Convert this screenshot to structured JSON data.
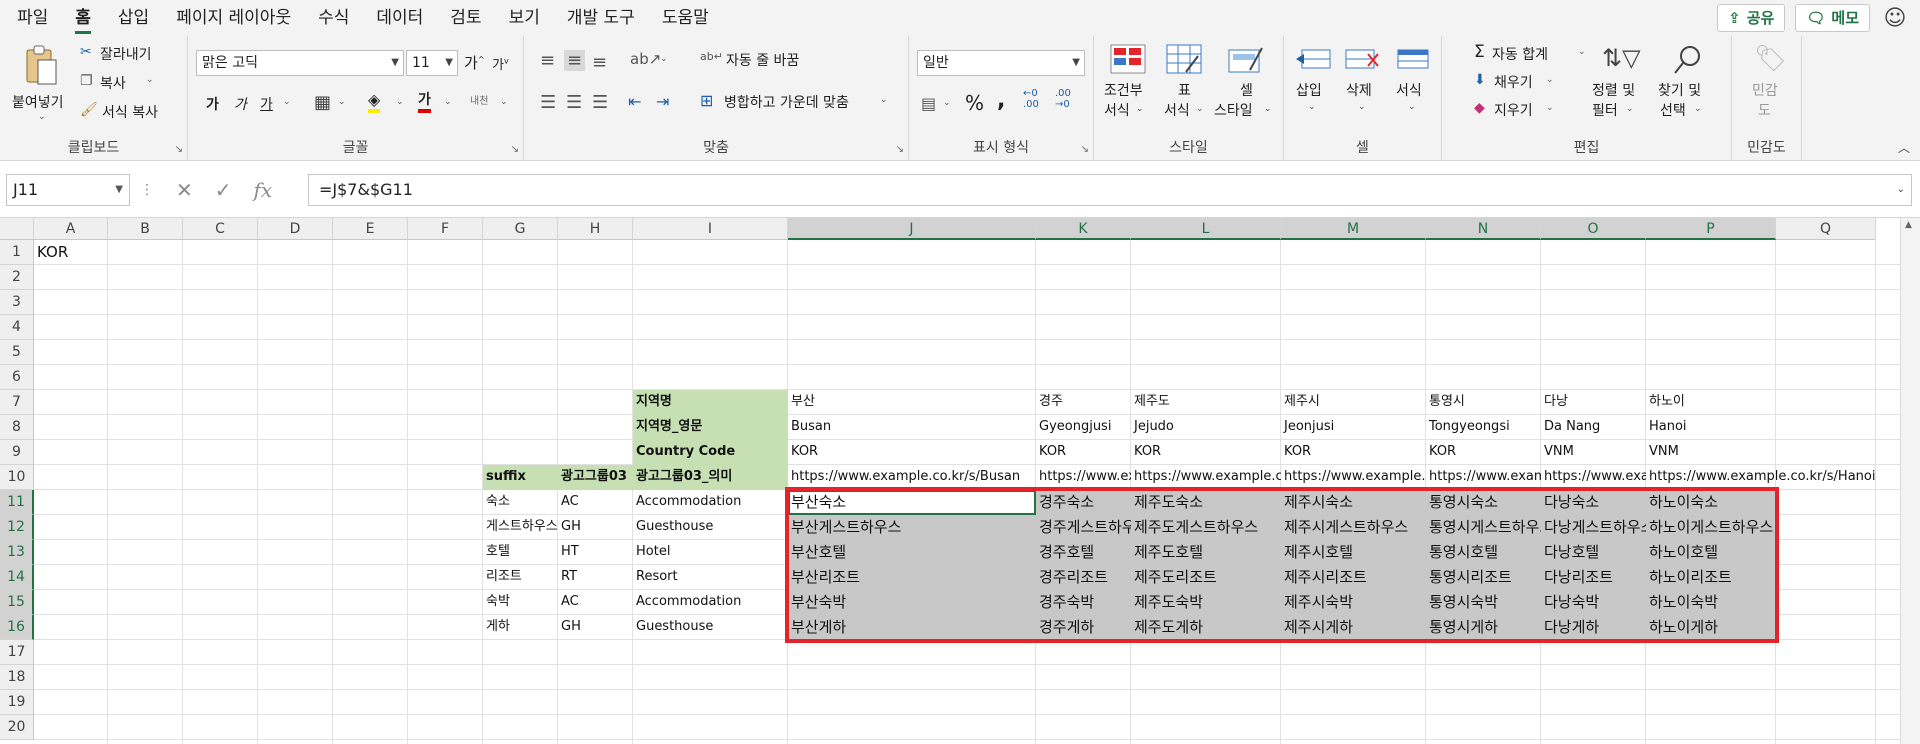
{
  "menu": {
    "tabs": [
      "파일",
      "홈",
      "삽입",
      "페이지 레이아웃",
      "수식",
      "데이터",
      "검토",
      "보기",
      "개발 도구",
      "도움말"
    ],
    "active_tab": "홈",
    "share_label": "공유",
    "comments_label": "메모"
  },
  "ribbon": {
    "clipboard": {
      "paste": "붙여넣기",
      "cut": "잘라내기",
      "copy": "복사",
      "format_painter": "서식 복사",
      "label": "클립보드"
    },
    "font": {
      "name": "맑은 고딕",
      "size": "11",
      "bold": "가",
      "italic": "가",
      "underline": "가",
      "font_color_glyph": "가",
      "phonetic": "내천",
      "label": "글꼴"
    },
    "alignment": {
      "wrap": "자동 줄 바꿈",
      "merge": "병합하고 가운데 맞춤",
      "label": "맞춤"
    },
    "number": {
      "format": "일반",
      "percent": "%",
      "comma": ",",
      "inc_decimal": ".00",
      "dec_decimal": ".00",
      "label": "표시 형식"
    },
    "styles": {
      "conditional": [
        "조건부",
        "서식"
      ],
      "table": [
        "표",
        "서식"
      ],
      "cell_styles": [
        "셀",
        "스타일"
      ],
      "label": "스타일"
    },
    "cells": {
      "insert": "삽입",
      "delete": "삭제",
      "format": "서식",
      "label": "셀"
    },
    "editing": {
      "autosum": "자동 합계",
      "fill": "채우기",
      "clear": "지우기",
      "sort": [
        "정렬 및",
        "필터"
      ],
      "find": [
        "찾기 및",
        "선택"
      ],
      "label": "편집"
    },
    "sensitivity": {
      "button": [
        "민감",
        "도"
      ],
      "label": "민감도"
    }
  },
  "formula_bar": {
    "name_box": "J11",
    "formula": "=J$7&$G11",
    "fx": "fx"
  },
  "sheet": {
    "columns": [
      "A",
      "B",
      "C",
      "D",
      "E",
      "F",
      "G",
      "H",
      "I",
      "J",
      "K",
      "L",
      "M",
      "N",
      "O",
      "P",
      "Q"
    ],
    "selected_columns": [
      "J",
      "K",
      "L",
      "M",
      "N",
      "O",
      "P"
    ],
    "rows": [
      "1",
      "2",
      "3",
      "4",
      "5",
      "6",
      "7",
      "8",
      "9",
      "10",
      "11",
      "12",
      "13",
      "14",
      "15",
      "16",
      "17",
      "18",
      "19",
      "20"
    ],
    "selected_rows": [
      "11",
      "12",
      "13",
      "14",
      "15",
      "16"
    ],
    "a1": "KOR",
    "headers": {
      "region": "지역명",
      "region_en": "지역명_영문",
      "country_code": "Country Code",
      "suffix": "suffix",
      "adgroup": "광고그룹03",
      "adgroup_meaning": "광고그룹03_의미"
    },
    "regions": [
      {
        "kr": "부산",
        "en": "Busan",
        "code": "KOR",
        "url": "https://www.example.co.kr/s/Busan"
      },
      {
        "kr": "경주",
        "en": "Gyeongjusi",
        "code": "KOR",
        "url": "https://www.example.co.kr/s/Gyeongjusi"
      },
      {
        "kr": "제주도",
        "en": "Jejudo",
        "code": "KOR",
        "url": "https://www.example.co.kr/s/Jejudo"
      },
      {
        "kr": "제주시",
        "en": "Jeonjusi",
        "code": "KOR",
        "url": "https://www.example.co.kr/s/Jeonjusi"
      },
      {
        "kr": "통영시",
        "en": "Tongyeongsi",
        "code": "KOR",
        "url": "https://www.example.co.kr/s/Tongyeongsi"
      },
      {
        "kr": "다낭",
        "en": "Da Nang",
        "code": "VNM",
        "url": "https://www.example.co.kr/s/DaNang"
      },
      {
        "kr": "하노이",
        "en": "Hanoi",
        "code": "VNM",
        "url": "https://www.example.co.kr/s/Hanoi"
      }
    ],
    "suffix_rows": [
      {
        "suffix": "숙소",
        "code": "AC",
        "meaning": "Accommodation"
      },
      {
        "suffix": "게스트하우스",
        "code": "GH",
        "meaning": "Guesthouse"
      },
      {
        "suffix": "호텔",
        "code": "HT",
        "meaning": "Hotel"
      },
      {
        "suffix": "리조트",
        "code": "RT",
        "meaning": "Resort"
      },
      {
        "suffix": "숙박",
        "code": "AC",
        "meaning": "Accommodation"
      },
      {
        "suffix": "게하",
        "code": "GH",
        "meaning": "Guesthouse"
      }
    ],
    "results": [
      [
        "부산숙소",
        "경주숙소",
        "제주도숙소",
        "제주시숙소",
        "통영시숙소",
        "다낭숙소",
        "하노이숙소"
      ],
      [
        "부산게스트하우스",
        "경주게스트하우스",
        "제주도게스트하우스",
        "제주시게스트하우스",
        "통영시게스트하우스",
        "다낭게스트하우스",
        "하노이게스트하우스"
      ],
      [
        "부산호텔",
        "경주호텔",
        "제주도호텔",
        "제주시호텔",
        "통영시호텔",
        "다낭호텔",
        "하노이호텔"
      ],
      [
        "부산리조트",
        "경주리조트",
        "제주도리조트",
        "제주시리조트",
        "통영시리조트",
        "다낭리조트",
        "하노이리조트"
      ],
      [
        "부산숙박",
        "경주숙박",
        "제주도숙박",
        "제주시숙박",
        "통영시숙박",
        "다낭숙박",
        "하노이숙박"
      ],
      [
        "부산게하",
        "경주게하",
        "제주도게하",
        "제주시게하",
        "통영시게하",
        "다낭게하",
        "하노이게하"
      ]
    ]
  }
}
